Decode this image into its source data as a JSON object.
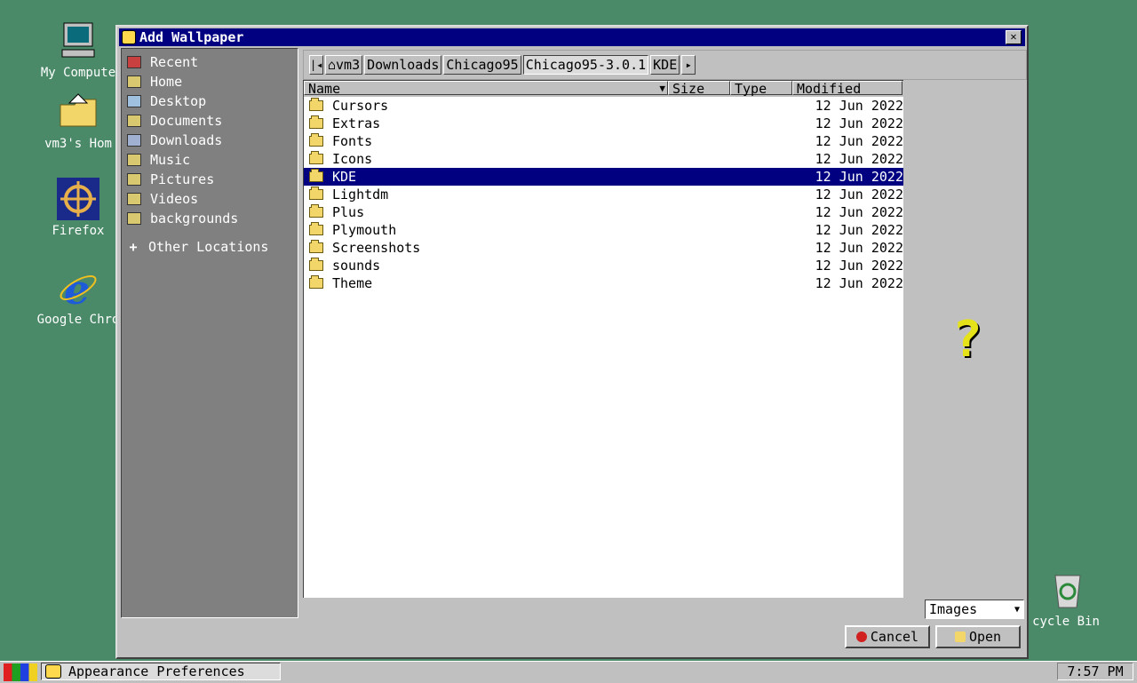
{
  "desktop": {
    "icons": [
      {
        "label": "My Compute",
        "icon": "computer-icon"
      },
      {
        "label": "vm3's Hom",
        "icon": "home-folder-icon"
      },
      {
        "label": "Firefox",
        "icon": "firefox-icon"
      },
      {
        "label": "Google Chro",
        "icon": "browser-icon"
      },
      {
        "label": "cycle Bin",
        "icon": "recycle-bin-icon"
      }
    ]
  },
  "dialog": {
    "title": "Add Wallpaper",
    "close_label": "✕",
    "sidebar": {
      "items": [
        {
          "label": "Recent",
          "icon": "recent-icon"
        },
        {
          "label": "Home",
          "icon": "home-icon"
        },
        {
          "label": "Desktop",
          "icon": "desktop-icon"
        },
        {
          "label": "Documents",
          "icon": "documents-icon"
        },
        {
          "label": "Downloads",
          "icon": "downloads-icon"
        },
        {
          "label": "Music",
          "icon": "music-icon"
        },
        {
          "label": "Pictures",
          "icon": "pictures-icon"
        },
        {
          "label": "Videos",
          "icon": "videos-icon"
        },
        {
          "label": "backgrounds",
          "icon": "folder-icon"
        }
      ],
      "other_locations": "Other Locations"
    },
    "pathbar": {
      "left_arrow": "|◂",
      "segments": [
        "vm3",
        "Downloads",
        "Chicago95",
        "Chicago95-3.0.1",
        "KDE"
      ],
      "active_index": 3,
      "right_arrow": "▸"
    },
    "columns": {
      "name": "Name",
      "size": "Size",
      "type": "Type",
      "modified": "Modified"
    },
    "files": [
      {
        "name": "Cursors",
        "modified": "12 Jun 2022"
      },
      {
        "name": "Extras",
        "modified": "12 Jun 2022"
      },
      {
        "name": "Fonts",
        "modified": "12 Jun 2022"
      },
      {
        "name": "Icons",
        "modified": "12 Jun 2022"
      },
      {
        "name": "KDE",
        "modified": "12 Jun 2022",
        "selected": true
      },
      {
        "name": "Lightdm",
        "modified": "12 Jun 2022"
      },
      {
        "name": "Plus",
        "modified": "12 Jun 2022"
      },
      {
        "name": "Plymouth",
        "modified": "12 Jun 2022"
      },
      {
        "name": "Screenshots",
        "modified": "12 Jun 2022"
      },
      {
        "name": "sounds",
        "modified": "12 Jun 2022"
      },
      {
        "name": "Theme",
        "modified": "12 Jun 2022"
      }
    ],
    "preview_glyph": "?",
    "filter": {
      "value": "Images"
    },
    "cancel_label": "Cancel",
    "open_label": "Open"
  },
  "taskbar": {
    "task_label": "Appearance Preferences",
    "clock": "7:57 PM"
  }
}
